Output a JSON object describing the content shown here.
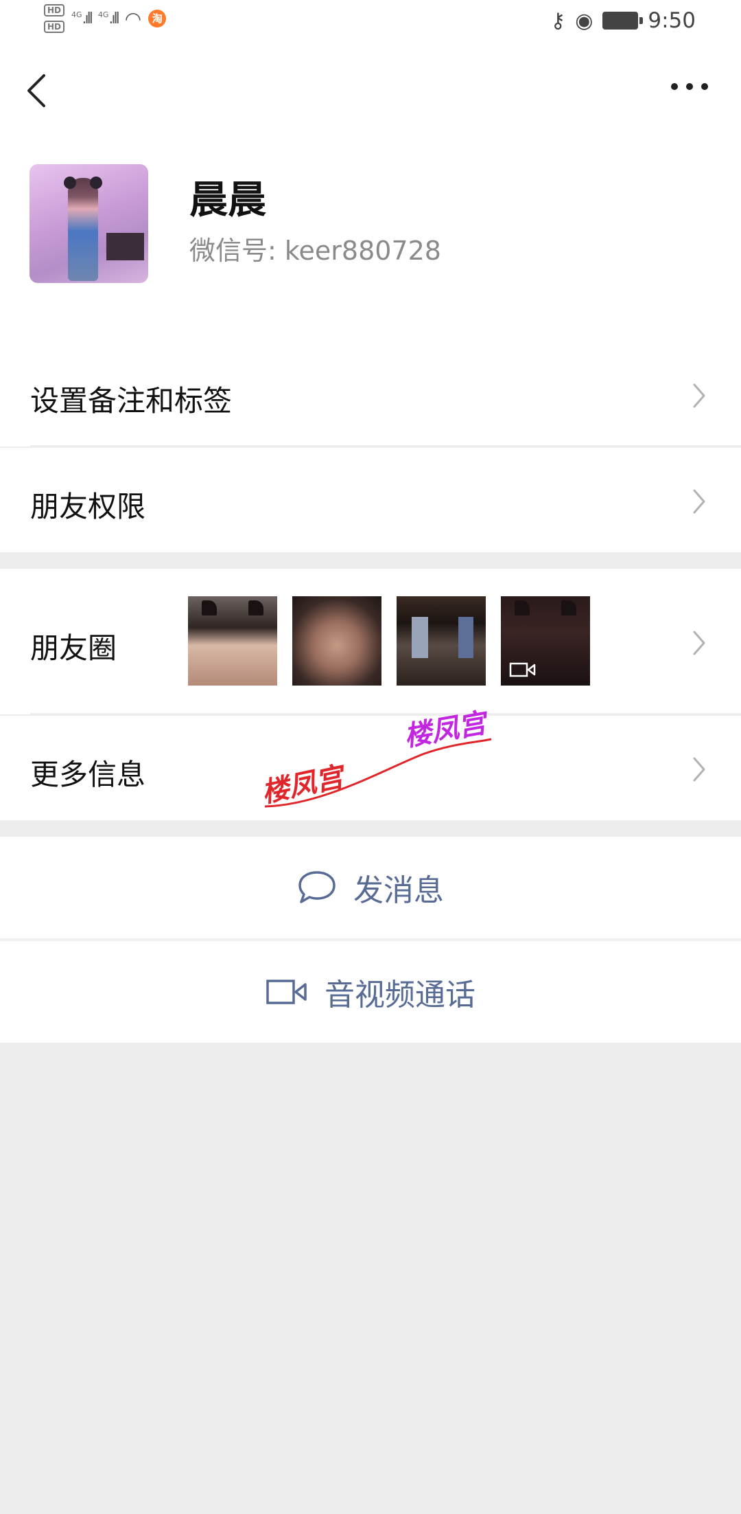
{
  "status_bar": {
    "time": "9:50",
    "hd_label_1": "HD",
    "hd_label_2": "HD",
    "network_1": "4G",
    "network_2": "4G",
    "badge": "淘"
  },
  "profile": {
    "name": "晨晨",
    "wechat_id": "微信号: keer880728"
  },
  "menu": {
    "remark_label": "设置备注和标签",
    "permissions_label": "朋友权限",
    "moments_label": "朋友圈",
    "more_info_label": "更多信息"
  },
  "watermark": {
    "text_1": "楼凤宫",
    "text_2": "楼凤宫",
    "color_1": "#e0262a",
    "color_2": "#c326e0"
  },
  "actions": {
    "send_message_label": "发消息",
    "call_label": "音视频通话"
  },
  "colors": {
    "link_blue": "#576b95",
    "background": "#ededed"
  }
}
